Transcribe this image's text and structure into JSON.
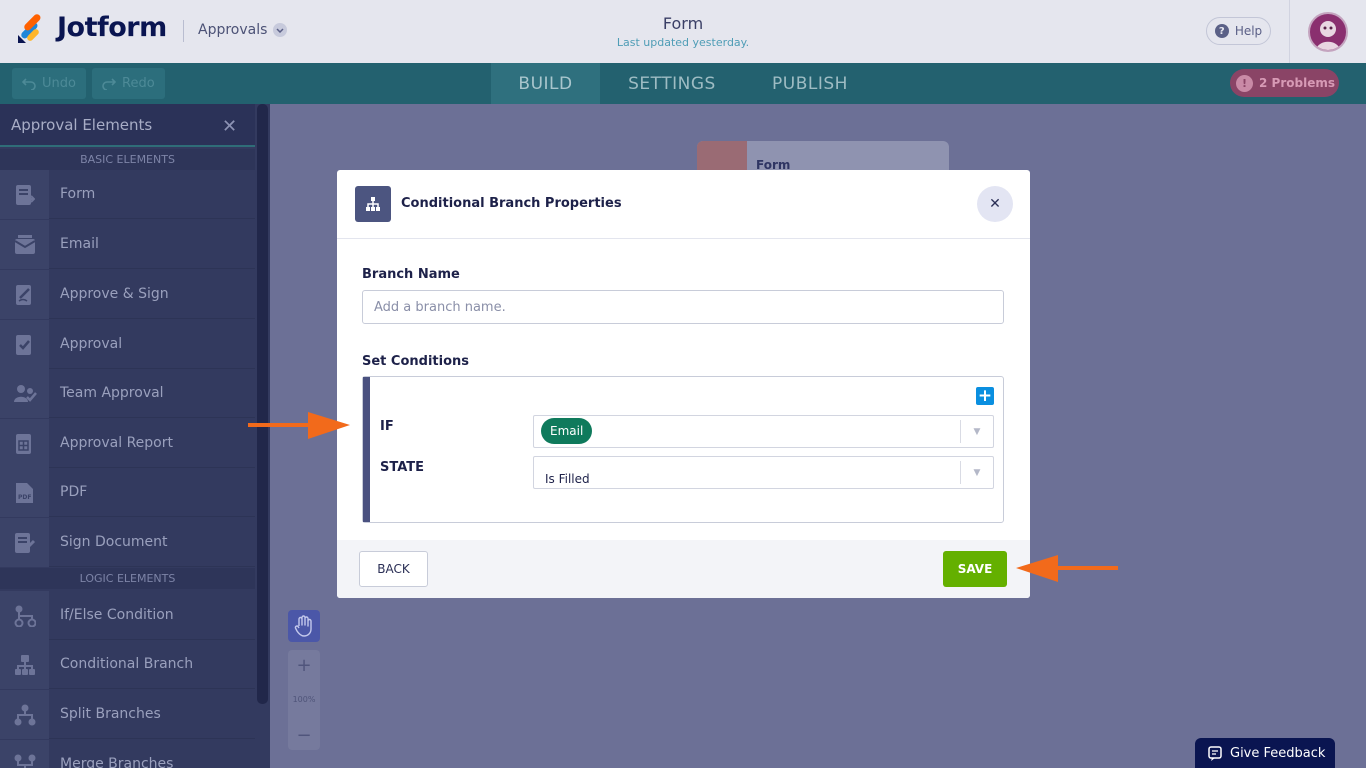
{
  "header": {
    "brand": "Jotform",
    "approvals_label": "Approvals",
    "form_title": "Form",
    "form_subtitle": "Last updated yesterday.",
    "help_label": "Help"
  },
  "toolbar": {
    "undo_label": "Undo",
    "redo_label": "Redo",
    "tabs": [
      "BUILD",
      "SETTINGS",
      "PUBLISH"
    ],
    "active_tab": "BUILD",
    "problems_label": "2 Problems"
  },
  "sidebar": {
    "title": "Approval Elements",
    "basic_section": "BASIC ELEMENTS",
    "basic_items": [
      {
        "label": "Form",
        "icon": "form-icon"
      },
      {
        "label": "Email",
        "icon": "email-icon"
      },
      {
        "label": "Approve & Sign",
        "icon": "approve-sign-icon"
      },
      {
        "label": "Approval",
        "icon": "approval-icon"
      },
      {
        "label": "Team Approval",
        "icon": "team-approval-icon"
      },
      {
        "label": "Approval Report",
        "icon": "approval-report-icon"
      },
      {
        "label": "PDF",
        "icon": "pdf-icon"
      },
      {
        "label": "Sign Document",
        "icon": "sign-document-icon"
      }
    ],
    "logic_section": "LOGIC ELEMENTS",
    "logic_items": [
      {
        "label": "If/Else Condition",
        "icon": "if-else-icon"
      },
      {
        "label": "Conditional Branch",
        "icon": "conditional-branch-icon"
      },
      {
        "label": "Split Branches",
        "icon": "split-branches-icon"
      },
      {
        "label": "Merge Branches",
        "icon": "merge-branches-icon"
      }
    ]
  },
  "canvas": {
    "node_label": "Form",
    "zoom_level": "100%",
    "feedback_label": "Give Feedback"
  },
  "modal": {
    "title": "Conditional Branch Properties",
    "branch_name_label": "Branch Name",
    "branch_name_placeholder": "Add a branch name.",
    "branch_name_value": "",
    "set_conditions_label": "Set Conditions",
    "if_label": "IF",
    "if_value": "Email",
    "state_label": "STATE",
    "state_value": "Is Filled",
    "back_label": "BACK",
    "save_label": "SAVE"
  },
  "colors": {
    "save_green": "#64b000",
    "chip_green": "#0f7a5c",
    "annotation_arrow": "#f26a1b",
    "toolbar_teal": "#23616f",
    "brand_navy": "#0a1551"
  }
}
